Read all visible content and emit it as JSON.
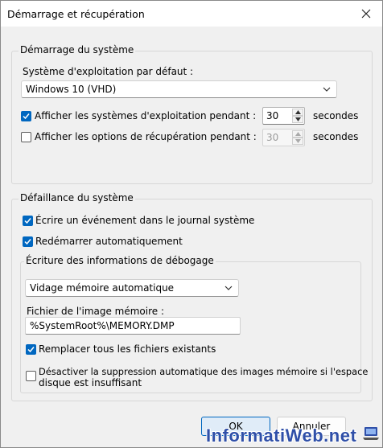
{
  "window": {
    "title": "Démarrage et récupération"
  },
  "startup": {
    "legend": "Démarrage du système",
    "default_os_label": "Système d'exploitation par défaut :",
    "default_os_value": "Windows 10 (VHD)",
    "show_os_list": {
      "label": "Afficher les systèmes d'exploitation pendant :",
      "checked": true,
      "value": "30",
      "unit": "secondes"
    },
    "show_recovery": {
      "label": "Afficher les options de récupération pendant :",
      "checked": false,
      "value": "30",
      "unit": "secondes"
    }
  },
  "failure": {
    "legend": "Défaillance du système",
    "write_event": {
      "label": "Écrire un événement dans le journal système",
      "checked": true
    },
    "auto_restart": {
      "label": "Redémarrer automatiquement",
      "checked": true
    },
    "debug": {
      "legend": "Écriture des informations de débogage",
      "dump_type": "Vidage mémoire automatique",
      "dump_file_label": "Fichier de l'image mémoire :",
      "dump_file_value": "%SystemRoot%\\MEMORY.DMP",
      "overwrite": {
        "label": "Remplacer tous les fichiers existants",
        "checked": true
      },
      "disable_auto_delete": {
        "label_line1": "Désactiver la suppression automatique des images mémoire si l'espace",
        "label_line2": "disque est insuffisant",
        "checked": false
      }
    }
  },
  "buttons": {
    "ok": "OK",
    "cancel": "Annuler"
  },
  "watermark": {
    "text": "InformatiWeb.net"
  },
  "colors": {
    "accent": "#0067c0",
    "window_bg": "#f0f0f0"
  }
}
